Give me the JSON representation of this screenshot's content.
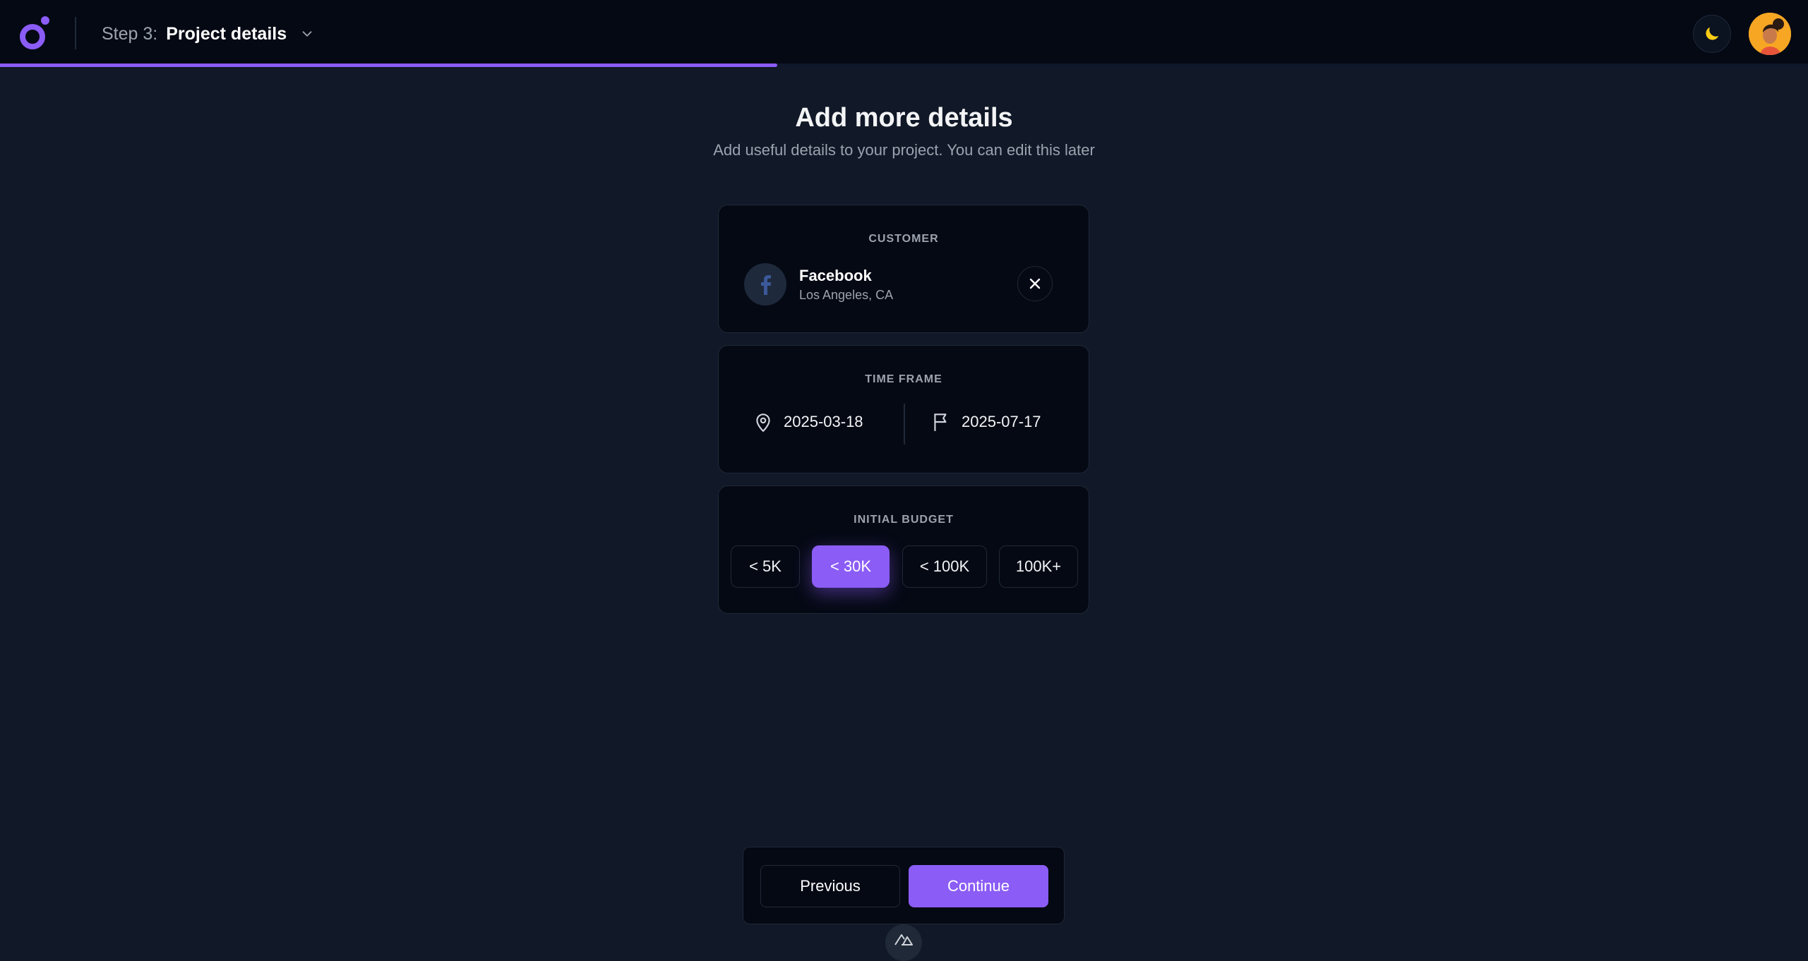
{
  "header": {
    "step_prefix": "Step 3:",
    "step_title": "Project details",
    "progress_percent": 43
  },
  "page": {
    "title": "Add more details",
    "subtitle": "Add useful details to your project. You can edit this later"
  },
  "customer": {
    "label": "CUSTOMER",
    "name": "Facebook",
    "location": "Los Angeles, CA"
  },
  "time_frame": {
    "label": "TIME FRAME",
    "start_date": "2025-03-18",
    "end_date": "2025-07-17"
  },
  "budget": {
    "label": "INITIAL BUDGET",
    "options": [
      "< 5K",
      "< 30K",
      "< 100K",
      "100K+"
    ],
    "selected": "< 30K"
  },
  "footer": {
    "previous_label": "Previous",
    "continue_label": "Continue"
  },
  "colors": {
    "accent": "#8b5cf6",
    "background": "#111827",
    "card": "#050914",
    "moon": "#facc15",
    "facebook": "#3b5998"
  },
  "icons": [
    "logo-icon",
    "chevron-down-icon",
    "moon-icon",
    "facebook-icon",
    "close-icon",
    "map-pin-icon",
    "flag-icon",
    "nuxt-icon"
  ]
}
